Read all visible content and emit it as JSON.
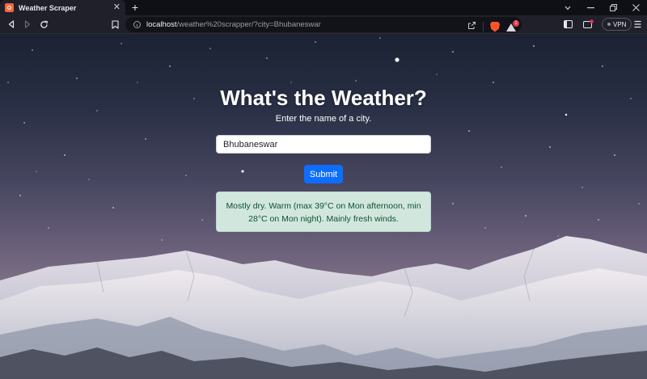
{
  "browser": {
    "tab": {
      "title": "Weather Scraper",
      "close_glyph": "✕"
    },
    "new_tab_glyph": "+",
    "url": {
      "host": "localhost",
      "path": "/weather%20scrapper/?city=Bhubaneswar"
    },
    "rewards_badge": "1",
    "vpn_label": "VPN",
    "brand_color": "#fb542b"
  },
  "page": {
    "heading": "What's the Weather?",
    "subtitle": "Enter the name of a city.",
    "city_input": {
      "value": "Bhubaneswar"
    },
    "submit_label": "Submit",
    "result_text": "Mostly dry. Warm (max 39°C on Mon afternoon, min 28°C on Mon night). Mainly fresh winds.",
    "colors": {
      "button": "#0d6efd",
      "result_bg": "#d1e7dd",
      "result_text": "#0f5132"
    }
  }
}
